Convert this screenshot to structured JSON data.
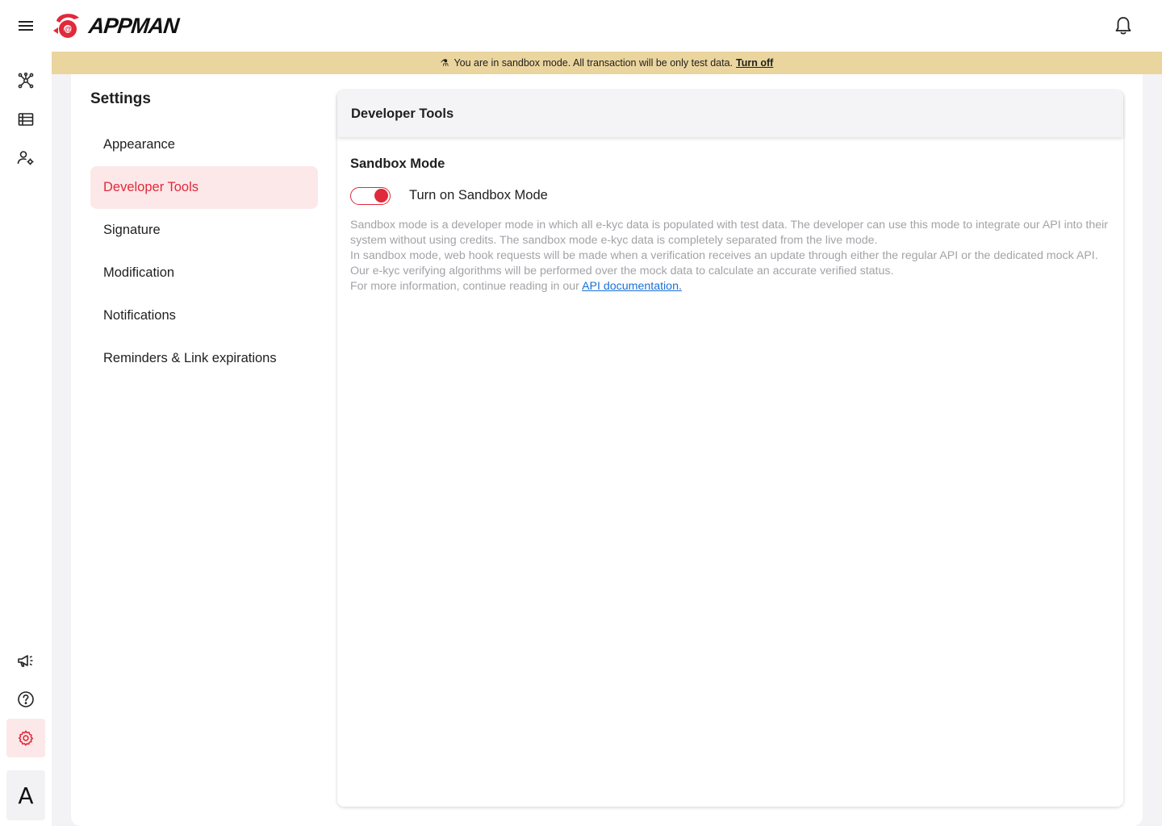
{
  "header": {
    "logo_text": "APPMAN",
    "menu_icon": "hamburger-menu-icon",
    "bell_icon": "bell-icon"
  },
  "rail": {
    "top_icons": [
      "network-icon",
      "table-icon",
      "user-settings-icon"
    ],
    "bottom_icons": [
      "megaphone-icon",
      "help-icon",
      "gear-icon"
    ],
    "avatar_letter": "A",
    "active_color": "#e02a3b"
  },
  "banner": {
    "message": "You are in sandbox mode. All transaction will be only test data.",
    "action": "Turn off",
    "color": "#ebd59f"
  },
  "settings": {
    "title": "Settings",
    "nav": [
      {
        "label": "Appearance",
        "active": false
      },
      {
        "label": "Developer Tools",
        "active": true
      },
      {
        "label": "Signature",
        "active": false
      },
      {
        "label": "Modification",
        "active": false
      },
      {
        "label": "Notifications",
        "active": false
      },
      {
        "label": "Reminders & Link expirations",
        "active": false
      }
    ]
  },
  "card": {
    "title": "Developer Tools",
    "section_title": "Sandbox Mode",
    "toggle_label": "Turn on Sandbox Mode",
    "toggle_on": true,
    "desc_line1": "Sandbox mode is a developer mode in which all e-kyc data is populated with test data. The developer can use this mode to integrate our API into their system without using credits. The sandbox mode e-kyc data is completely separated from the live mode.",
    "desc_line2": "In sandbox mode, web hook requests will be made when a verification receives an update through either the regular API or the dedicated mock API. Our e-kyc verifying algorithms will be performed over the mock data to calculate an accurate verified status.",
    "desc_line3": "For more information, continue reading in our",
    "link_text": "API documentation."
  }
}
